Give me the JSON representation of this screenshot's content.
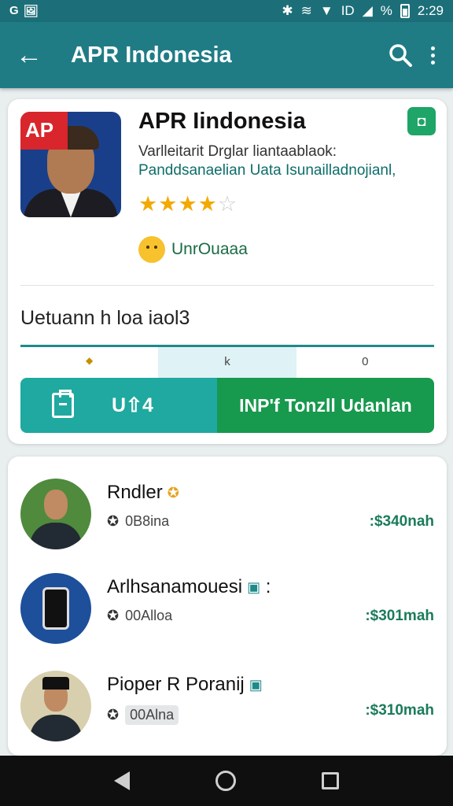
{
  "status_bar": {
    "left_icons": [
      "G",
      "🖼"
    ],
    "right_icons": [
      "bluetooth-icon",
      "vibrate-icon",
      "wifi-icon",
      "lte-icon",
      "signal-icon"
    ],
    "battery_text": "%",
    "time": "2:29"
  },
  "app_bar": {
    "title": "APR Indonesia",
    "back_glyph": "←"
  },
  "app_card": {
    "logo_text": "AP",
    "title": "APR Iindonesia",
    "badge_glyph": "◘",
    "subtitle_line1": "Varlleitarit Drglar liantaablaok:",
    "subtitle_line2": "Panddsanaelian Uata Isunailladnojianl,",
    "rating": 4,
    "rating_max": 5,
    "review_text": "UnrOuaaa",
    "section_title": "Uetuann h loa iaol3",
    "tabs": [
      {
        "label": "",
        "icon": "◆"
      },
      {
        "label": "k",
        "icon": "◆"
      },
      {
        "label": "0",
        "icon": "◆"
      }
    ],
    "action_left_label": "U⇧4",
    "action_right_label": "INP'f Tonzll Udanlan"
  },
  "list": [
    {
      "name": "Rndler",
      "verify_glyph": "✪",
      "verify_color": "#e8a21f",
      "meta": "0B8ina",
      "price": ":$340nah",
      "avatar_bg": "#4f8a3d",
      "chip": false
    },
    {
      "name": "Arlhsanamouesi",
      "verify_glyph": "▣",
      "verify_color": "#1f8a88",
      "extra": ":",
      "meta": "00Alloa",
      "price": ":$301mah",
      "avatar_bg": "#1d4f9a",
      "chip": false
    },
    {
      "name": "Pioper R Poranij",
      "verify_glyph": "▣",
      "verify_color": "#1f8a88",
      "meta": "00Alna",
      "price": ":$310mah",
      "avatar_bg": "#d8cfae",
      "chip": true
    }
  ],
  "colors": {
    "appbar": "#1f7c85",
    "teal_button": "#1fa9a0",
    "green_button": "#17994e",
    "star": "#f2a900"
  }
}
